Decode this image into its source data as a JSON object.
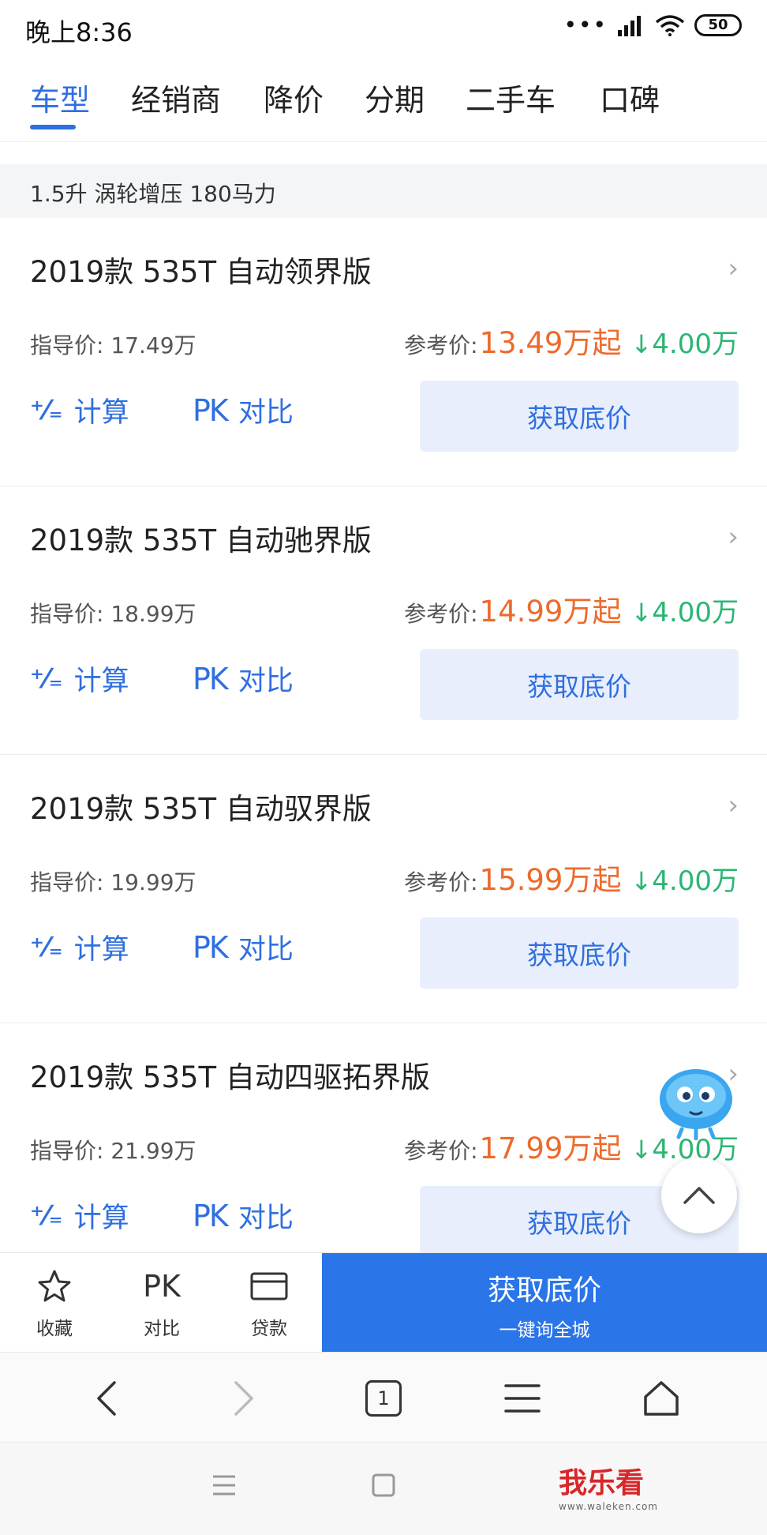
{
  "status_bar": {
    "time": "晚上8:36",
    "battery": "50"
  },
  "tabs": [
    {
      "label": "车型",
      "active": true
    },
    {
      "label": "经销商",
      "active": false
    },
    {
      "label": "降价",
      "active": false
    },
    {
      "label": "分期",
      "active": false
    },
    {
      "label": "二手车",
      "active": false
    },
    {
      "label": "口碑",
      "active": false
    }
  ],
  "spec_header": "1.5升 涡轮增压 180马力",
  "cards": [
    {
      "title": "2019款 535T 自动领界版",
      "guide_label": "指导价:",
      "guide_price": "17.49万",
      "ref_label": "参考价:",
      "ref_price": "13.49万起",
      "drop": "4.00万",
      "calc_label": "计算",
      "pk_label": "对比",
      "pk_icon": "PK",
      "price_btn": "获取底价"
    },
    {
      "title": "2019款 535T 自动驰界版",
      "guide_label": "指导价:",
      "guide_price": "18.99万",
      "ref_label": "参考价:",
      "ref_price": "14.99万起",
      "drop": "4.00万",
      "calc_label": "计算",
      "pk_label": "对比",
      "pk_icon": "PK",
      "price_btn": "获取底价"
    },
    {
      "title": "2019款 535T 自动驭界版",
      "guide_label": "指导价:",
      "guide_price": "19.99万",
      "ref_label": "参考价:",
      "ref_price": "15.99万起",
      "drop": "4.00万",
      "calc_label": "计算",
      "pk_label": "对比",
      "pk_icon": "PK",
      "price_btn": "获取底价"
    },
    {
      "title": "2019款 535T 自动四驱拓界版",
      "guide_label": "指导价:",
      "guide_price": "21.99万",
      "ref_label": "参考价:",
      "ref_price": "17.99万起",
      "drop": "4.00万",
      "calc_label": "计算",
      "pk_label": "对比",
      "pk_icon": "PK",
      "price_btn": "获取底价"
    }
  ],
  "action_bar": {
    "favorite": "收藏",
    "compare_icon": "PK",
    "compare": "对比",
    "loan": "贷款",
    "cta_main": "获取底价",
    "cta_sub": "一键询全城"
  },
  "browser_nav": {
    "tab_count": "1"
  },
  "watermark": {
    "text": "我乐看",
    "sub": "www.waleken.com"
  },
  "colors": {
    "accent": "#2f6fe0",
    "cta": "#2a75e8",
    "price": "#ee6a2c",
    "drop": "#2bb673"
  },
  "icons": [
    "calculator-icon",
    "pk-icon",
    "chevron-right-icon",
    "star-icon",
    "card-icon",
    "back-icon",
    "forward-icon",
    "tabs-icon",
    "menu-icon",
    "home-icon",
    "scroll-top-icon",
    "mascot-icon"
  ]
}
